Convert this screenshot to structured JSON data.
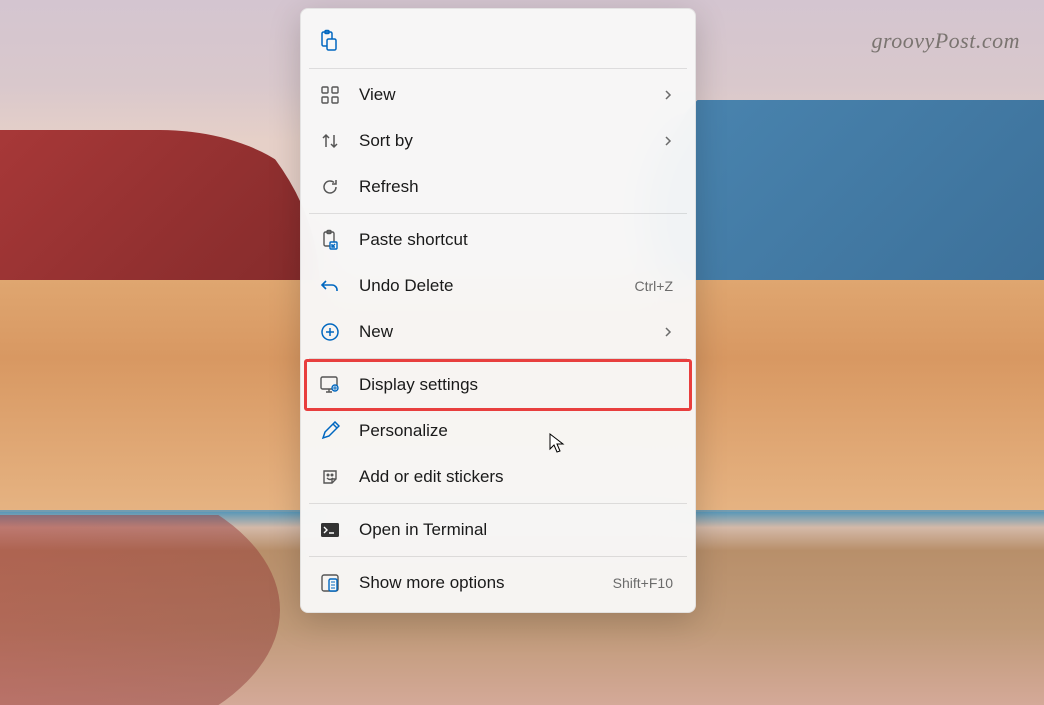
{
  "watermark": "groovyPost.com",
  "menu": {
    "view": {
      "label": "View",
      "has_submenu": true
    },
    "sort_by": {
      "label": "Sort by",
      "has_submenu": true
    },
    "refresh": {
      "label": "Refresh"
    },
    "paste_shortcut": {
      "label": "Paste shortcut"
    },
    "undo_delete": {
      "label": "Undo Delete",
      "shortcut": "Ctrl+Z"
    },
    "new": {
      "label": "New",
      "has_submenu": true
    },
    "display_settings": {
      "label": "Display settings",
      "highlighted": true
    },
    "personalize": {
      "label": "Personalize"
    },
    "add_stickers": {
      "label": "Add or edit stickers"
    },
    "open_terminal": {
      "label": "Open in Terminal"
    },
    "show_more": {
      "label": "Show more options",
      "shortcut": "Shift+F10"
    }
  }
}
